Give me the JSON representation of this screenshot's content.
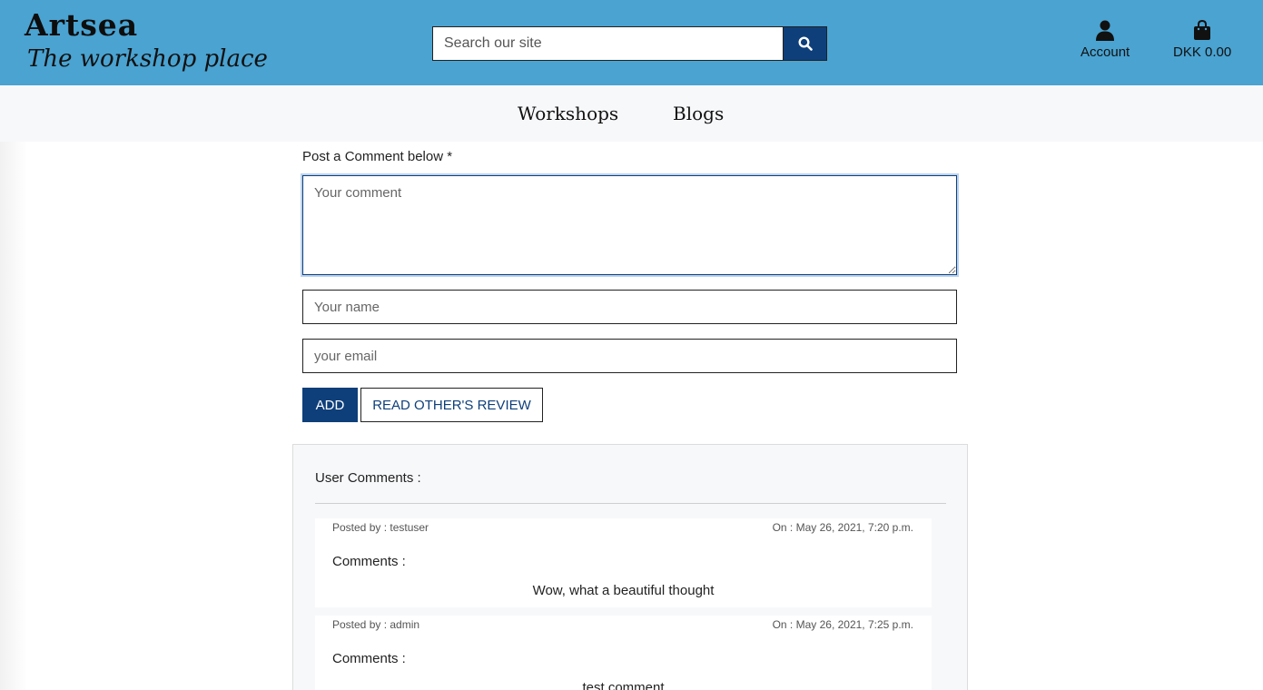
{
  "header": {
    "brand": "Artsea",
    "tagline": "The workshop place",
    "search_placeholder": "Search our site",
    "account_label": "Account",
    "bag_total": "DKK 0.00"
  },
  "nav": {
    "items": [
      {
        "label": "Workshops"
      },
      {
        "label": "Blogs"
      }
    ]
  },
  "form": {
    "label": "Post a Comment below *",
    "comment_placeholder": "Your comment",
    "name_placeholder": "Your name",
    "email_placeholder": "your email",
    "add_label": "ADD",
    "review_label": "READ OTHER'S REVIEW"
  },
  "comments": {
    "heading": "User Comments :",
    "items": [
      {
        "author": "Posted by : testuser",
        "date": "On : May 26, 2021, 7:20 p.m.",
        "label": "Comments :",
        "text": "Wow, what a beautiful thought"
      },
      {
        "author": "Posted by : admin",
        "date": "On : May 26, 2021, 7:25 p.m.",
        "label": "Comments :",
        "text": "test comment"
      }
    ]
  },
  "colors": {
    "header_bg": "#4aa3d1",
    "primary": "#0e3f7a",
    "subnav_bg": "#f7f8fa"
  }
}
